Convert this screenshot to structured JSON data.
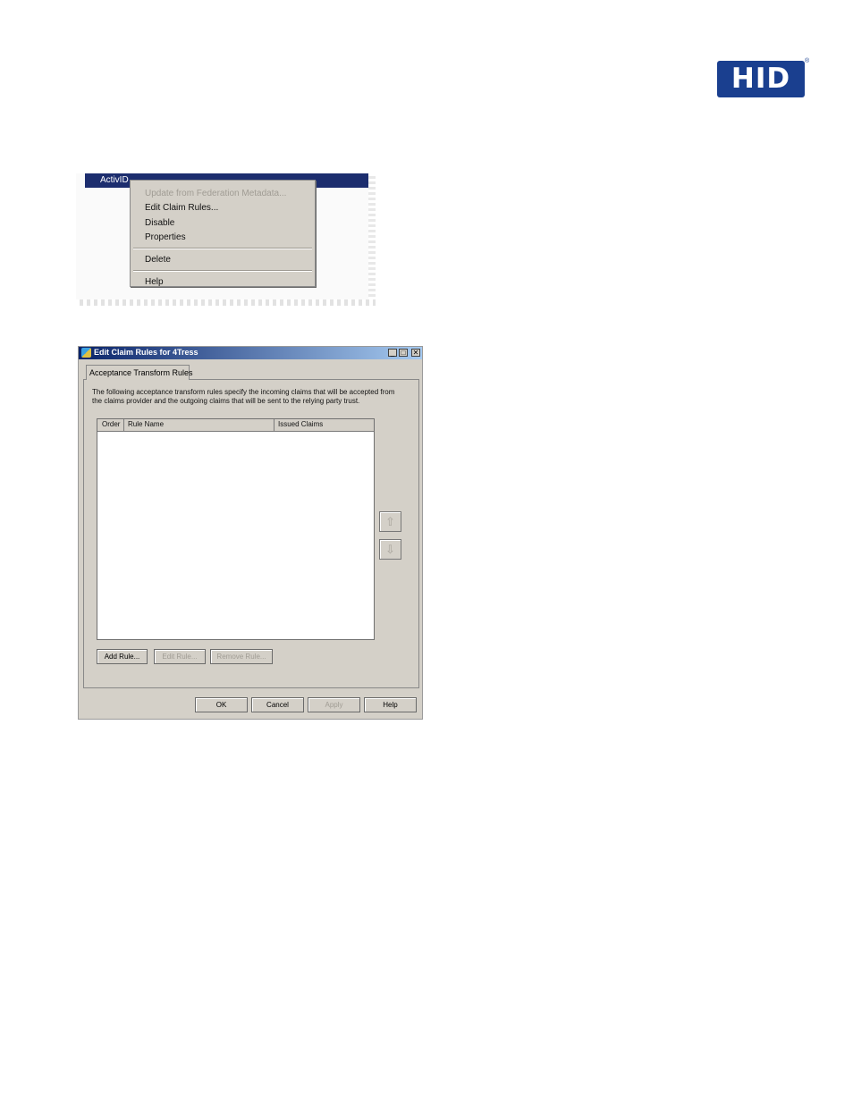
{
  "logo": {
    "text": "HID",
    "reg": "®",
    "color": "#1a3f8f"
  },
  "context_menu": {
    "node_label": "ActivID",
    "items": [
      {
        "label": "Update from Federation Metadata...",
        "enabled": false
      },
      {
        "label": "Edit Claim Rules...",
        "enabled": true
      },
      {
        "label": "Disable",
        "enabled": true
      },
      {
        "label": "Properties",
        "enabled": true
      },
      {
        "label": "Delete",
        "enabled": true
      },
      {
        "label": "Help",
        "enabled": true
      }
    ]
  },
  "dialog": {
    "title": "Edit Claim Rules for 4Tress",
    "window_buttons": {
      "minimize": "_",
      "maximize": "□",
      "close": "✕"
    },
    "tab_label": "Acceptance Transform Rules",
    "description": "The following acceptance transform rules specify the incoming claims that will be accepted from the claims provider and the outgoing claims that will be sent to the relying party trust.",
    "columns": [
      "Order",
      "Rule Name",
      "Issued Claims"
    ],
    "rows": [],
    "move_up_icon": "arrow-up-icon",
    "move_down_icon": "arrow-down-icon",
    "rule_buttons": {
      "add": "Add Rule...",
      "edit": "Edit Rule...",
      "remove": "Remove Rule..."
    },
    "footer_buttons": {
      "ok": "OK",
      "cancel": "Cancel",
      "apply": "Apply",
      "help": "Help"
    }
  }
}
